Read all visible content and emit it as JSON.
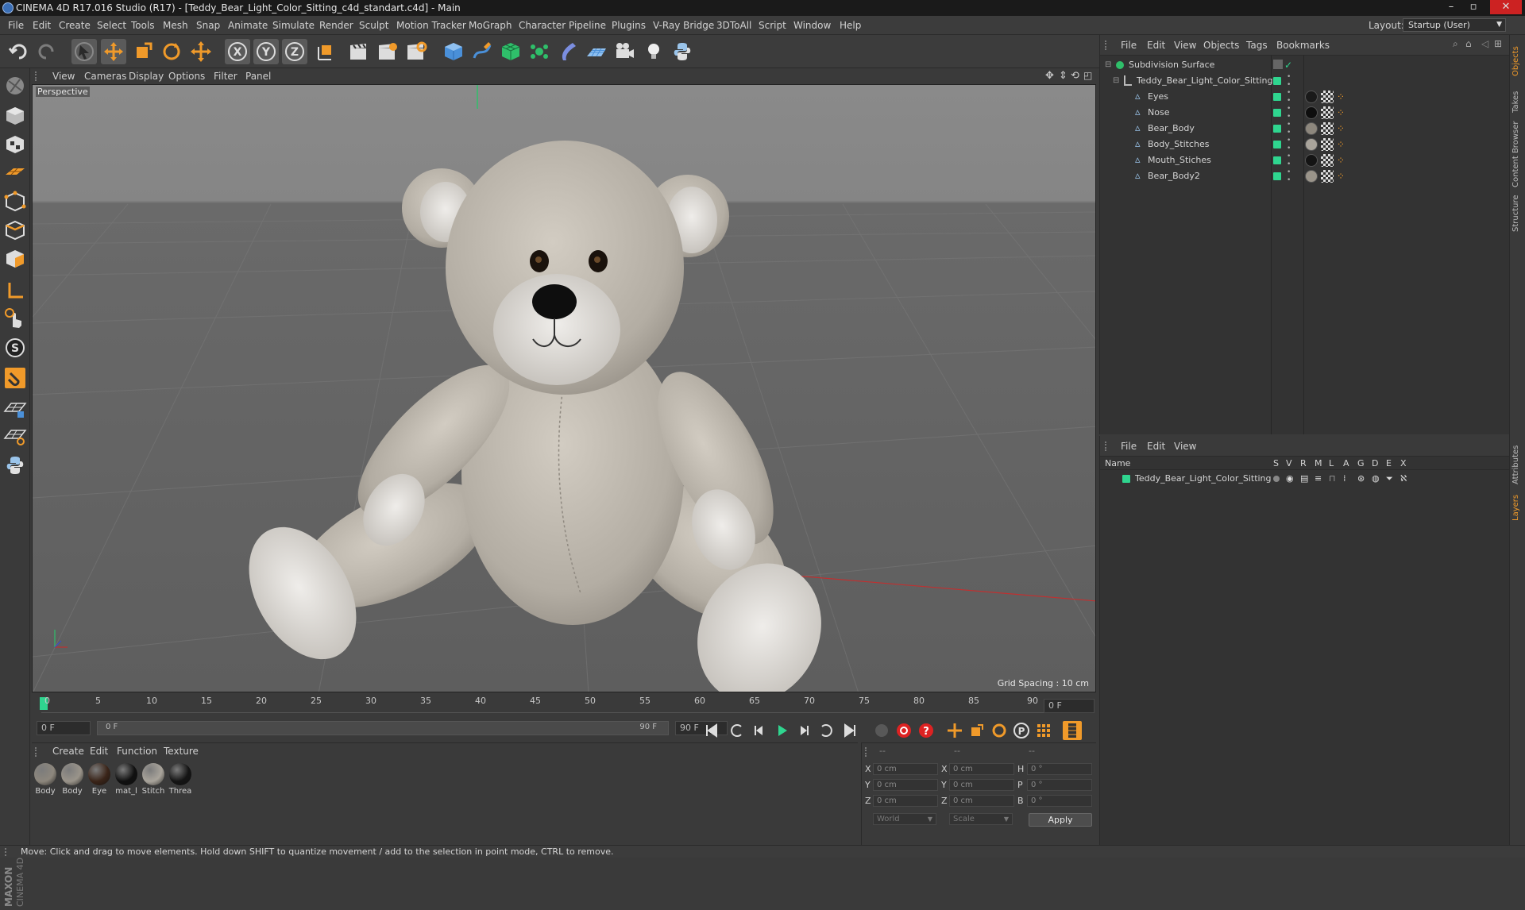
{
  "window": {
    "title": "CINEMA 4D R17.016 Studio (R17) - [Teddy_Bear_Light_Color_Sitting_c4d_standart.c4d] - Main"
  },
  "menubar": {
    "items": [
      "File",
      "Edit",
      "Create",
      "Select",
      "Tools",
      "Mesh",
      "Snap",
      "Animate",
      "Simulate",
      "Render",
      "Sculpt",
      "Motion Tracker",
      "MoGraph",
      "Character",
      "Pipeline",
      "Plugins",
      "V-Ray Bridge",
      "3DToAll",
      "Script",
      "Window",
      "Help"
    ],
    "layout_label": "Layout:",
    "layout_value": "Startup (User)"
  },
  "viewport": {
    "menu": [
      "View",
      "Cameras",
      "Display",
      "Options",
      "Filter",
      "Panel"
    ],
    "label": "Perspective",
    "grid_spacing": "Grid Spacing : 10 cm"
  },
  "timeline": {
    "ticks": [
      "0",
      "5",
      "10",
      "15",
      "20",
      "25",
      "30",
      "35",
      "40",
      "45",
      "50",
      "55",
      "60",
      "65",
      "70",
      "75",
      "80",
      "85",
      "90"
    ],
    "current_frame": "0 F"
  },
  "transport": {
    "start_field": "0 F",
    "range_start": "0 F",
    "range_end": "90 F",
    "end_field": "90 F"
  },
  "materials": {
    "menu": [
      "Create",
      "Edit",
      "Function",
      "Texture"
    ],
    "items": [
      {
        "label": "Body",
        "color": "#8d877d"
      },
      {
        "label": "Body",
        "color": "#9a948a"
      },
      {
        "label": "Eye",
        "color": "#3a2418"
      },
      {
        "label": "mat_l",
        "color": "#101010"
      },
      {
        "label": "Stitch",
        "color": "#a9a49b"
      },
      {
        "label": "Threa",
        "color": "#141414"
      }
    ]
  },
  "coords": {
    "header": [
      "--",
      "--",
      "--"
    ],
    "rows": [
      {
        "a": "X",
        "av": "0 cm",
        "b": "X",
        "bv": "0 cm",
        "c": "H",
        "cv": "0 °"
      },
      {
        "a": "Y",
        "av": "0 cm",
        "b": "Y",
        "bv": "0 cm",
        "c": "P",
        "cv": "0 °"
      },
      {
        "a": "Z",
        "av": "0 cm",
        "b": "Z",
        "bv": "0 cm",
        "c": "B",
        "cv": "0 °"
      }
    ],
    "world": "World",
    "scale": "Scale",
    "apply": "Apply"
  },
  "object_manager": {
    "menu": [
      "File",
      "Edit",
      "View",
      "Objects",
      "Tags",
      "Bookmarks"
    ],
    "objects": [
      {
        "name": "Subdivision Surface",
        "level": 0
      },
      {
        "name": "Teddy_Bear_Light_Color_Sitting",
        "level": 1
      },
      {
        "name": "Eyes",
        "level": 2,
        "mat": "#1a1a1a"
      },
      {
        "name": "Nose",
        "level": 2,
        "mat": "#0e0e0e"
      },
      {
        "name": "Bear_Body",
        "level": 2,
        "mat": "#8d877d"
      },
      {
        "name": "Body_Stitches",
        "level": 2,
        "mat": "#a9a49b"
      },
      {
        "name": "Mouth_Stiches",
        "level": 2,
        "mat": "#141414"
      },
      {
        "name": "Bear_Body2",
        "level": 2,
        "mat": "#9a948a"
      }
    ]
  },
  "layer_manager": {
    "menu": [
      "File",
      "Edit",
      "View"
    ],
    "header_name": "Name",
    "columns": [
      "S",
      "V",
      "R",
      "M",
      "L",
      "A",
      "G",
      "D",
      "E",
      "X"
    ],
    "layers": [
      {
        "name": "Teddy_Bear_Light_Color_Sitting"
      }
    ]
  },
  "right_tabs": [
    "Objects",
    "Takes",
    "Content Browser",
    "Structure",
    "Attributes",
    "Layers"
  ],
  "status": {
    "text": "Move: Click and drag to move elements. Hold down SHIFT to quantize movement / add to the selection in point mode, CTRL to remove."
  },
  "colors": {
    "accent_blue": "#4a90d9",
    "green_tag": "#2fd58f",
    "orange_tool": "#f09a2a"
  }
}
